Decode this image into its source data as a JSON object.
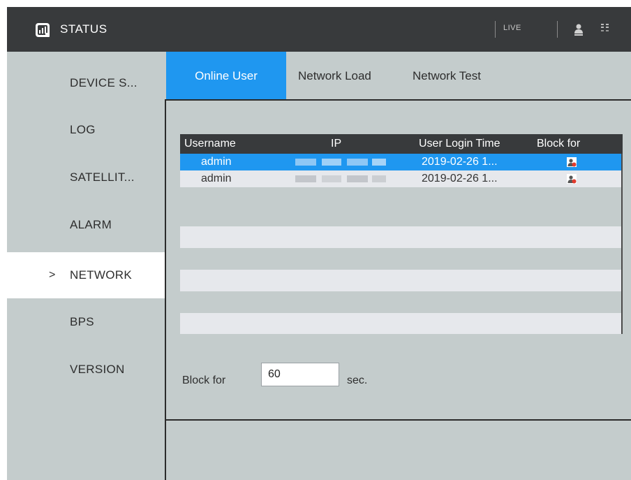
{
  "titlebar": {
    "title": "STATUS",
    "icons": [
      "status-logo-icon",
      "user-icon",
      "grid-icon"
    ],
    "live_label": "LIVE"
  },
  "sidebar": {
    "items": [
      {
        "label": "DEVICE S..."
      },
      {
        "label": "LOG"
      },
      {
        "label": "SATELLIT..."
      },
      {
        "label": "ALARM"
      },
      {
        "label": "NETWORK",
        "active": true,
        "marker": ">"
      },
      {
        "label": "BPS"
      },
      {
        "label": "VERSION"
      }
    ]
  },
  "tabs": [
    {
      "label": "Online User",
      "active": true
    },
    {
      "label": "Network Load"
    },
    {
      "label": "Network Test"
    }
  ],
  "table": {
    "headers": [
      "Username",
      "IP",
      "User Login Time",
      "Block for"
    ],
    "rows": [
      {
        "username": "admin",
        "ip": "",
        "login_time": "2019-02-26 1...",
        "block_icon": "block-user-icon",
        "selected": true
      },
      {
        "username": "admin",
        "ip": "",
        "login_time": "2019-02-26 1...",
        "block_icon": "block-user-icon"
      }
    ]
  },
  "block": {
    "label": "Block for",
    "value": "60",
    "unit": "sec."
  },
  "colors": {
    "accent": "#1f97f0",
    "titlebar": "#383a3c",
    "background": "#c4cccc",
    "row_alt": "#e6e8ec",
    "block_icon_red": "#e23b2e"
  }
}
